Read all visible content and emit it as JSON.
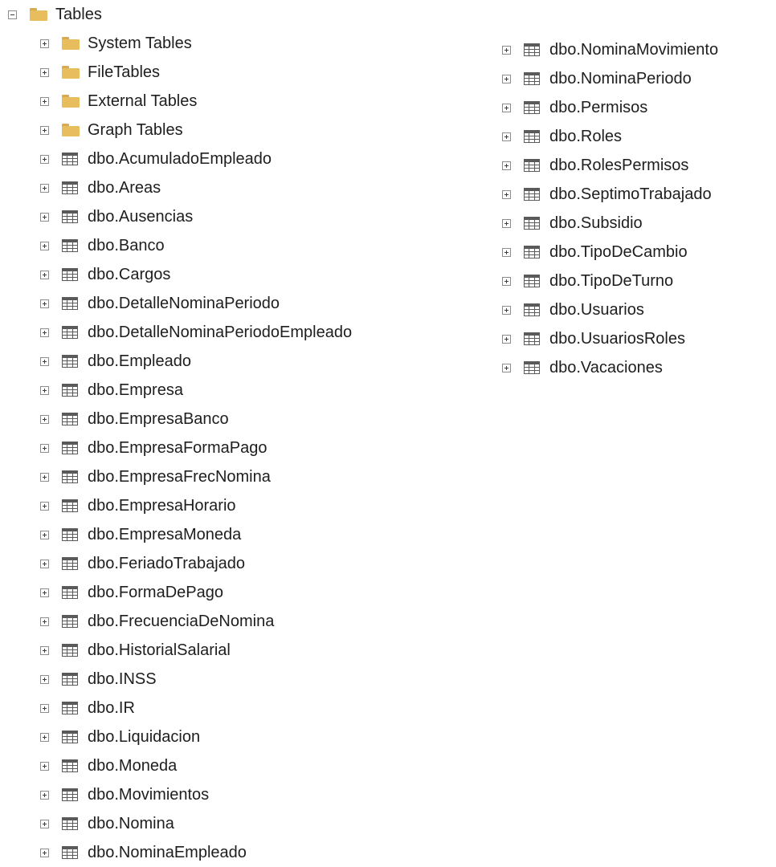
{
  "tree": {
    "root": {
      "label": "Tables",
      "expanded": true,
      "icon": "folder-icon"
    },
    "folders": [
      {
        "label": "System Tables"
      },
      {
        "label": "FileTables"
      },
      {
        "label": "External Tables"
      },
      {
        "label": "Graph Tables"
      }
    ],
    "tables_col1": [
      "dbo.AcumuladoEmpleado",
      "dbo.Areas",
      "dbo.Ausencias",
      "dbo.Banco",
      "dbo.Cargos",
      "dbo.DetalleNominaPeriodo",
      "dbo.DetalleNominaPeriodoEmpleado",
      "dbo.Empleado",
      "dbo.Empresa",
      "dbo.EmpresaBanco",
      "dbo.EmpresaFormaPago",
      "dbo.EmpresaFrecNomina",
      "dbo.EmpresaHorario",
      "dbo.EmpresaMoneda",
      "dbo.FeriadoTrabajado",
      "dbo.FormaDePago",
      "dbo.FrecuenciaDeNomina",
      "dbo.HistorialSalarial",
      "dbo.INSS",
      "dbo.IR",
      "dbo.Liquidacion",
      "dbo.Moneda",
      "dbo.Movimientos",
      "dbo.Nomina",
      "dbo.NominaEmpleado"
    ],
    "tables_col2": [
      "dbo.NominaMovimiento",
      "dbo.NominaPeriodo",
      "dbo.Permisos",
      "dbo.Roles",
      "dbo.RolesPermisos",
      "dbo.SeptimoTrabajado",
      "dbo.Subsidio",
      "dbo.TipoDeCambio",
      "dbo.TipoDeTurno",
      "dbo.Usuarios",
      "dbo.UsuariosRoles",
      "dbo.Vacaciones"
    ]
  },
  "colors": {
    "folder": "#e8bd5e",
    "table_header": "#5a5a5a",
    "text": "#1e1e1e"
  }
}
